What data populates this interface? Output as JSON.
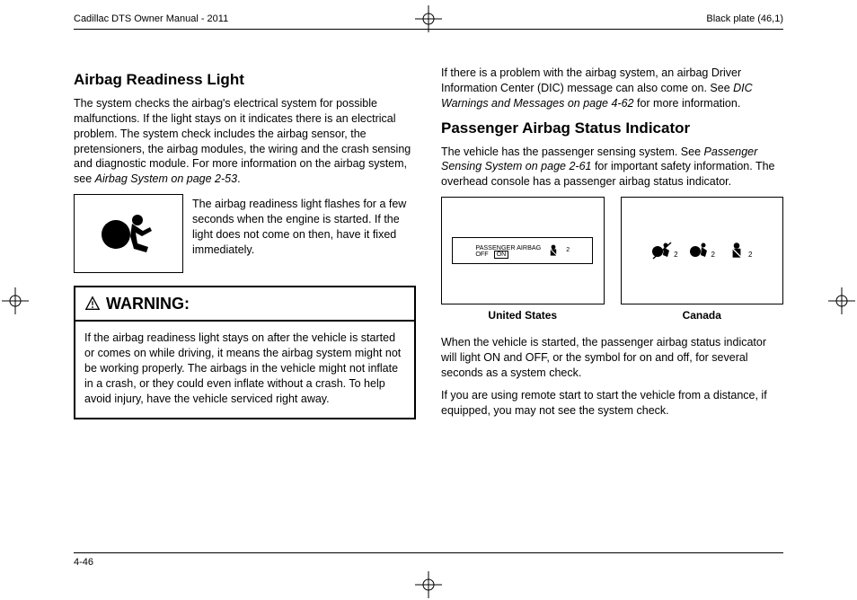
{
  "header": {
    "left": "Cadillac DTS Owner Manual - 2011",
    "right": "Black plate (46,1)"
  },
  "page_number": "4-46",
  "left_col": {
    "h1": "Airbag Readiness Light",
    "p1": "The system checks the airbag's electrical system for possible malfunctions. If the light stays on it indicates there is an electrical problem. The system check includes the airbag sensor, the pretensioners, the airbag modules, the wiring and the crash sensing and diagnostic module. For more information on the airbag system, see ",
    "p1_ref": "Airbag System on page 2-53",
    "p1_tail": ".",
    "airbag_caption": "The airbag readiness light flashes for a few seconds when the engine is started. If the light does not come on then, have it fixed immediately.",
    "warning_label": "WARNING:",
    "warning_body": "If the airbag readiness light stays on after the vehicle is started or comes on while driving, it means the airbag system might not be working properly. The airbags in the vehicle might not inflate in a crash, or they could even inflate without a crash. To help avoid injury, have the vehicle serviced right away."
  },
  "right_col": {
    "p0a": "If there is a problem with the airbag system, an airbag Driver Information Center (DIC) message can also come on. See ",
    "p0_ref": "DIC Warnings and Messages on page 4-62",
    "p0b": " for more information.",
    "h1": "Passenger Airbag Status Indicator",
    "p1a": "The vehicle has the passenger sensing system. See ",
    "p1_ref": "Passenger Sensing System on page 2-61",
    "p1b": " for important safety information. The overhead console has a passenger airbag status indicator.",
    "us_line1": "PASSENGER AIRBAG",
    "us_off": "OFF",
    "us_on": "ON",
    "us_two": "2",
    "cap_us": "United States",
    "cap_ca": "Canada",
    "p2": "When the vehicle is started, the passenger airbag status indicator will light ON and OFF, or the symbol for on and off, for several seconds as a system check.",
    "p3": "If you are using remote start to start the vehicle from a distance, if equipped, you may not see the system check."
  }
}
